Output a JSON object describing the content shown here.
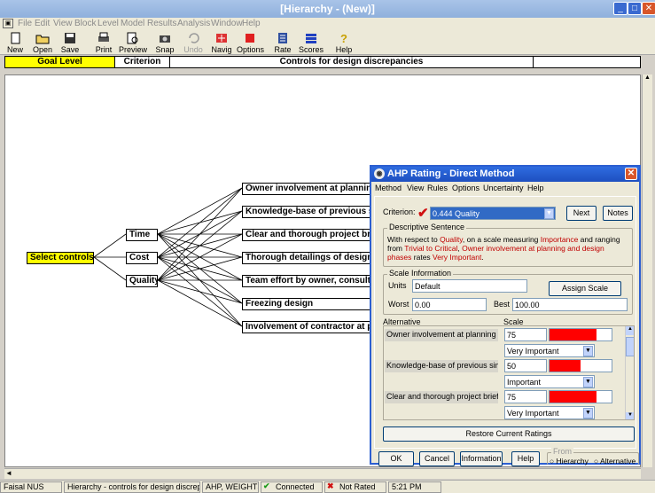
{
  "window": {
    "title": "[Hierarchy - (New)]",
    "min_label": "_",
    "max_label": "□",
    "close_label": "✕"
  },
  "menu": [
    "File",
    "Edit",
    "View",
    "Block",
    "Level",
    "Model",
    "Results",
    "Analysis",
    "Window",
    "Help"
  ],
  "toolbar": [
    {
      "label": "New",
      "icon": "new-icon",
      "enabled": true
    },
    {
      "label": "Open",
      "icon": "open-icon",
      "enabled": true
    },
    {
      "label": "Save",
      "icon": "save-icon",
      "enabled": true
    },
    {
      "label": "Print",
      "icon": "print-icon",
      "enabled": true
    },
    {
      "label": "Preview",
      "icon": "preview-icon",
      "enabled": true
    },
    {
      "label": "Snap",
      "icon": "snap-icon",
      "enabled": true
    },
    {
      "label": "Undo",
      "icon": "undo-icon",
      "enabled": false
    },
    {
      "label": "Navig",
      "icon": "navig-icon",
      "enabled": true
    },
    {
      "label": "Options",
      "icon": "options-icon",
      "enabled": true
    },
    {
      "label": "Rate",
      "icon": "rate-icon",
      "enabled": true
    },
    {
      "label": "Scores",
      "icon": "scores-icon",
      "enabled": true
    },
    {
      "label": "Help",
      "icon": "help-icon",
      "enabled": true
    }
  ],
  "level_header": {
    "goal": "Goal Level",
    "criterion": "Criterion",
    "alternatives": "Controls for design discrepancies"
  },
  "hierarchy": {
    "goal": "Select controls",
    "criteria": [
      "Time",
      "Cost",
      "Quality"
    ],
    "alternatives": [
      "Owner involvement at planning",
      "Knowledge-base of previous sir",
      "Clear and thorough project bri",
      "Thorough detailings of design",
      "Team effort by owner, consulta",
      "Freezing design",
      "Involvement of contractor at pla"
    ]
  },
  "dialog": {
    "title": "AHP Rating - Direct Method",
    "close_label": "✕",
    "menu": [
      "Method",
      "View",
      "Rules",
      "Options",
      "Uncertainty",
      "Help"
    ],
    "criterion_label": "Criterion:",
    "criterion_value": "0.444  Quality",
    "next_label": "Next",
    "notes_label": "Notes",
    "descriptive_title": "Descriptive Sentence",
    "sentence": {
      "p1": "With respect to ",
      "p2": "Quality",
      "p3": ", on a scale measuring ",
      "p4": "Importance",
      "p5": " and ranging from ",
      "p6": "Trivial to Critical",
      "p7": ", ",
      "p8": "Owner involvement at planning and design phases",
      "p9": " rates ",
      "p10": "Very Important",
      "p11": "."
    },
    "scale_title": "Scale Information",
    "units_label": "Units",
    "units_value": "Default",
    "assign_scale_label": "Assign Scale",
    "worst_label": "Worst",
    "worst_value": "0.00",
    "best_label": "Best",
    "best_value": "100.00",
    "alternative_col": "Alternative",
    "scale_col": "Scale",
    "ratings": [
      {
        "alt": "Owner involvement at planning and",
        "score": "75",
        "fill": 0.75,
        "verbal": "Very Important"
      },
      {
        "alt": "Knowledge-base of previous similar",
        "score": "50",
        "fill": 0.5,
        "verbal": "Important"
      },
      {
        "alt": "Clear and thorough project brief",
        "score": "75",
        "fill": 0.75,
        "verbal": "Very Important"
      }
    ],
    "restore_label": "Restore Current Ratings",
    "ok_label": "OK",
    "cancel_label": "Cancel",
    "information_label": "Information",
    "help_label": "Help",
    "from_label": "From",
    "hierarchy_radio": "Hierarchy",
    "alternative_radio": "Alternative"
  },
  "status": {
    "user": "Faisal NUS",
    "doc": "Hierarchy - controls for design discrepancies",
    "mode": "AHP, WEIGHTS",
    "connected": "Connected",
    "not_rated": "Not Rated",
    "time": "5:21 PM"
  },
  "colors": {
    "goal_fill": "#ffff00",
    "bar_red": "#ff0000",
    "dialog_blue": "#2c5fd1"
  }
}
